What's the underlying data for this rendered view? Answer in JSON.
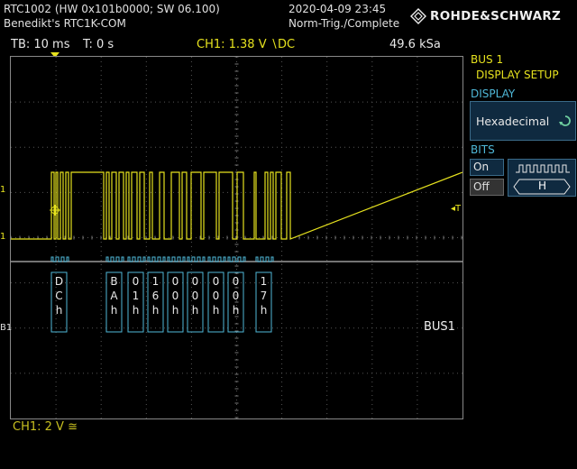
{
  "header": {
    "device": "RTC1002 (HW 0x101b0000; SW 06.100)",
    "name": "Benedikt's RTC1K-COM",
    "datetime": "2020-04-09 23:45",
    "trigger_mode": "Norm-Trig./Complete",
    "brand": "ROHDE&SCHWARZ"
  },
  "toolbar": {
    "timebase": "TB: 10 ms",
    "trigger_time": "T: 0 s",
    "channel_trigger": "CH1: 1.38 V ∖DC",
    "sample_rate": "49.6 kSa"
  },
  "side_panel": {
    "bus_label": "BUS 1",
    "menu_title": "DISPLAY SETUP",
    "display_section": "DISPLAY",
    "display_value": "Hexadecimal",
    "bits_section": "BITS",
    "on_label": "On",
    "off_label": "Off",
    "bits_glyph": "H"
  },
  "screen": {
    "ch1_marker": "1",
    "trigger_marker": "T",
    "bus_marker": "B1",
    "bus_label": "BUS1",
    "bytes": [
      {
        "hi": "D",
        "lo": "C"
      },
      {
        "hi": "B",
        "lo": "A"
      },
      {
        "hi": "0",
        "lo": "1"
      },
      {
        "hi": "1",
        "lo": "6"
      },
      {
        "hi": "0",
        "lo": "0"
      },
      {
        "hi": "0",
        "lo": "0"
      },
      {
        "hi": "0",
        "lo": "0"
      },
      {
        "hi": "0",
        "lo": "0"
      },
      {
        "hi": "1",
        "lo": "7"
      }
    ],
    "hex_suffix": "h"
  },
  "footer": {
    "ch1_scale": "CH1: 2 V ≅"
  },
  "colors": {
    "ch1": "#e6e21e",
    "bus": "#4fb8d8",
    "grid": "#555555"
  }
}
